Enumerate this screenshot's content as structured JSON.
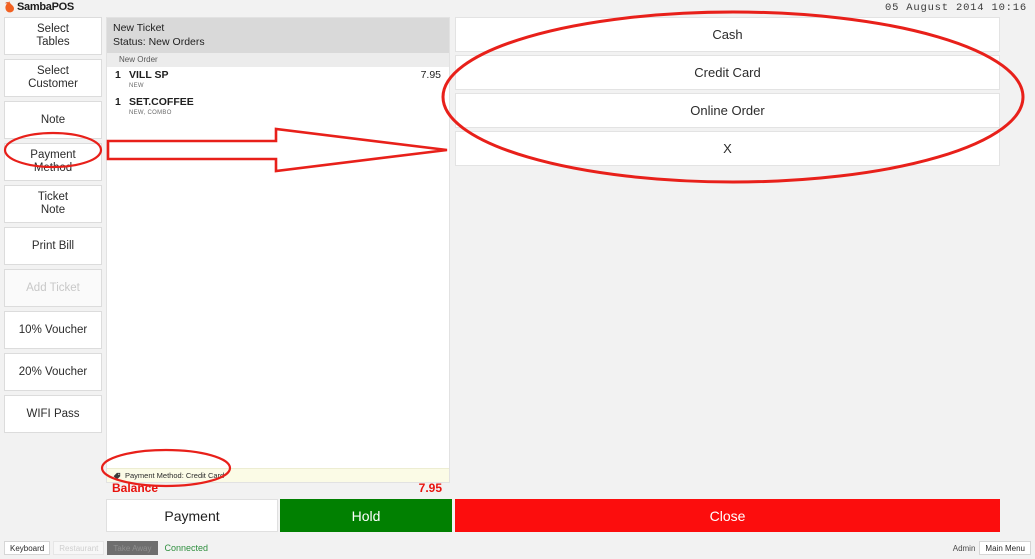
{
  "titlebar": {
    "app_name": "SambaPOS",
    "datetime": "05 August 2014 10:16"
  },
  "sidebar": {
    "items": [
      {
        "label": "Select\nTables",
        "enabled": true
      },
      {
        "label": "Select\nCustomer",
        "enabled": true
      },
      {
        "label": "Note",
        "enabled": true
      },
      {
        "label": "Payment\nMethod",
        "enabled": true
      },
      {
        "label": "Ticket\nNote",
        "enabled": true
      },
      {
        "label": "Print Bill",
        "enabled": true
      },
      {
        "label": "Add Ticket",
        "enabled": false
      },
      {
        "label": "10% Voucher",
        "enabled": true
      },
      {
        "label": "20% Voucher",
        "enabled": true
      },
      {
        "label": "WIFI Pass",
        "enabled": true
      }
    ]
  },
  "ticket": {
    "title": "New Ticket",
    "status": "Status: New Orders",
    "group_label": "New Order",
    "orders": [
      {
        "qty": "1",
        "name": "VILL SP",
        "tags": "NEW",
        "price": "7.95"
      },
      {
        "qty": "1",
        "name": "SET.COFFEE",
        "tags": "NEW, COMBO",
        "price": ""
      }
    ],
    "ticket_tag": "Payment Method: Credit Card",
    "balance_label": "Balance",
    "balance_value": "7.95"
  },
  "payment_panel": {
    "buttons": [
      {
        "label": "Cash"
      },
      {
        "label": "Credit Card"
      },
      {
        "label": "Online Order"
      },
      {
        "label": "X"
      }
    ]
  },
  "footer": {
    "payment_label": "Payment",
    "hold_label": "Hold",
    "close_label": "Close"
  },
  "statusbar": {
    "keyboard_label": "Keyboard",
    "restaurant_label": "Restaurant",
    "takeaway_label": "Take Away",
    "connection_status": "Connected",
    "user": "Admin",
    "main_menu_label": "Main Menu"
  },
  "colors": {
    "accent_red": "#e8120c",
    "annotation_red": "#e8201a",
    "hold_green": "#018001",
    "close_red": "#fc0d0d",
    "connected_green": "#2f8f3f",
    "logo_orange": "#f26122"
  }
}
